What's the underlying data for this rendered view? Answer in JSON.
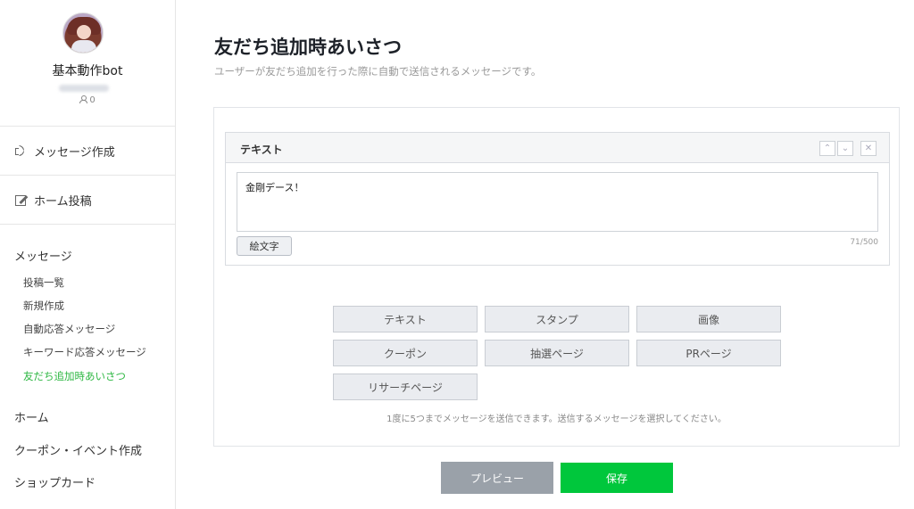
{
  "sidebar": {
    "bot_name": "基本動作bot",
    "friend_count": "0",
    "primary_nav": [
      {
        "label": "メッセージ作成",
        "icon": "speaker-icon"
      },
      {
        "label": "ホーム投稿",
        "icon": "edit-icon"
      }
    ],
    "message_section": {
      "title": "メッセージ",
      "items": [
        {
          "label": "投稿一覧"
        },
        {
          "label": "新規作成"
        },
        {
          "label": "自動応答メッセージ"
        },
        {
          "label": "キーワード応答メッセージ"
        },
        {
          "label": "友だち追加時あいさつ",
          "active": true
        }
      ]
    },
    "other_nav": [
      {
        "label": "ホーム"
      },
      {
        "label": "クーポン・イベント作成"
      },
      {
        "label": "ショップカード"
      }
    ],
    "active_color": "#2db742"
  },
  "main": {
    "title": "友だち追加時あいさつ",
    "description": "ユーザーが友だち追加を行った際に自動で送信されるメッセージです。",
    "message_card": {
      "type_label": "テキスト",
      "text_value": "金剛デース！",
      "emoji_button": "絵文字",
      "char_count": "71/500",
      "move_up_icon": "chevron-up-icon",
      "move_down_icon": "chevron-down-icon",
      "close_icon": "close-icon"
    },
    "type_buttons": [
      {
        "label": "テキスト"
      },
      {
        "label": "スタンプ"
      },
      {
        "label": "画像"
      },
      {
        "label": "クーポン"
      },
      {
        "label": "抽選ページ"
      },
      {
        "label": "PRページ"
      },
      {
        "label": "リサーチページ"
      }
    ],
    "hint": "1度に5つまでメッセージを送信できます。送信するメッセージを選択してください。",
    "preview_button": "プレビュー",
    "save_button": "保存",
    "save_color": "#00c73c"
  }
}
